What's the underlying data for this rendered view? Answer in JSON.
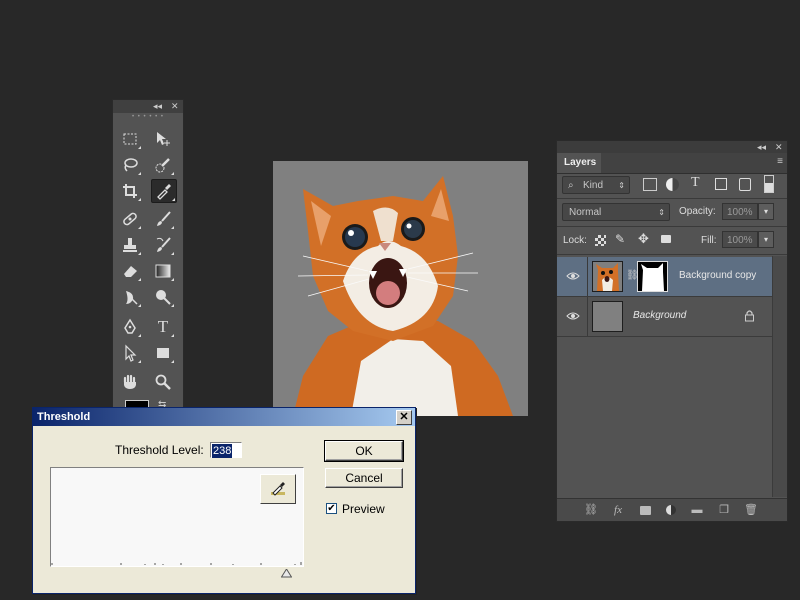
{
  "tools_panel": {
    "collapse_glyph": "◂◂",
    "close_glyph": "✕",
    "tools": [
      {
        "name": "rectangular-marquee-tool",
        "icon": "marquee-icon"
      },
      {
        "name": "move-tool",
        "icon": "move-icon"
      },
      {
        "name": "lasso-tool",
        "icon": "lasso-icon"
      },
      {
        "name": "quick-selection-tool",
        "icon": "quick-selection-icon"
      },
      {
        "name": "crop-tool",
        "icon": "crop-icon"
      },
      {
        "name": "eyedropper-tool",
        "icon": "eyedropper-icon",
        "selected": true
      },
      {
        "name": "spot-healing-tool",
        "icon": "bandage-icon"
      },
      {
        "name": "brush-tool",
        "icon": "brush-icon"
      },
      {
        "name": "clone-stamp-tool",
        "icon": "stamp-icon"
      },
      {
        "name": "history-brush-tool",
        "icon": "history-brush-icon"
      },
      {
        "name": "eraser-tool",
        "icon": "eraser-icon"
      },
      {
        "name": "gradient-tool",
        "icon": "gradient-icon"
      },
      {
        "name": "blur-tool",
        "icon": "blur-icon"
      },
      {
        "name": "dodge-tool",
        "icon": "dodge-icon"
      },
      {
        "name": "pen-tool",
        "icon": "pen-icon"
      },
      {
        "name": "type-tool",
        "icon": "type-icon",
        "glyph": "T"
      },
      {
        "name": "path-selection-tool",
        "icon": "arrow-icon"
      },
      {
        "name": "rectangle-tool",
        "icon": "rectangle-icon"
      },
      {
        "name": "hand-tool",
        "icon": "hand-icon"
      },
      {
        "name": "zoom-tool",
        "icon": "zoom-icon"
      }
    ]
  },
  "layers_panel": {
    "tab_label": "Layers",
    "filter_label": "Kind",
    "blend_mode": "Normal",
    "opacity_label": "Opacity:",
    "opacity_value": "100%",
    "lock_label": "Lock:",
    "fill_label": "Fill:",
    "fill_value": "100%",
    "layers": [
      {
        "name": "Background copy",
        "active": true,
        "has_mask": true
      },
      {
        "name": "Background",
        "active": false,
        "locked": true
      }
    ]
  },
  "threshold_dialog": {
    "title": "Threshold",
    "close_glyph": "✕",
    "level_label": "Threshold Level:",
    "level_value": "238",
    "ok_label": "OK",
    "cancel_label": "Cancel",
    "preview_label": "Preview",
    "preview_checked": true,
    "preview_check_glyph": "✔",
    "slider_value": 238
  },
  "colors": {
    "workspace_bg": "#282828",
    "panel_bg": "#535353",
    "active_layer": "#5e6f83",
    "dialog_title_start": "#0a246a",
    "dialog_title_end": "#a6caf0",
    "canvas_bg": "#808080",
    "cat_fur": "#cf6a22"
  }
}
